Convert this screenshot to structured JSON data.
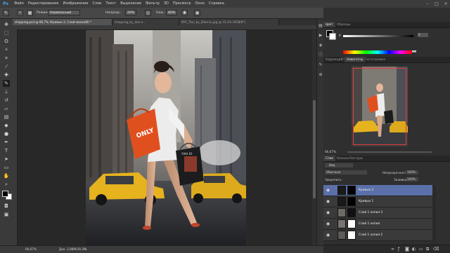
{
  "app": {
    "logo": "Ps"
  },
  "menu": [
    "Файл",
    "Редактирование",
    "Изображение",
    "Слои",
    "Текст",
    "Выделение",
    "Фильтр",
    "3D",
    "Просмотр",
    "Окно",
    "Справка"
  ],
  "options": {
    "mode_label": "Режим:",
    "mode_value": "Нормальный",
    "opacity_label": "Непрозр.:",
    "opacity_value": "20%",
    "flow_label": "Наж.:",
    "flow_value": "80%",
    "workspace": "Основная рабочая среда"
  },
  "tabs": [
    {
      "label": "shopping.psd @ 66,7% (Кривые 2, Слой-маска/8) *",
      "state": "active"
    },
    {
      "label": "shopping_by_dan-s...",
      "state": "inactive"
    },
    {
      "label": "NYC_Taxi_by_IEbeniu.jpg @ 33,3% (RGB/8*)",
      "state": "inactive"
    }
  ],
  "status": {
    "zoom": "66,67%",
    "doc": "Док: 2,88M/29,3M"
  },
  "color_panel": {
    "tabs": [
      "Цвет",
      "Образцы"
    ],
    "k_value": "0",
    "k_label": "K"
  },
  "adjust_panel": {
    "tabs": [
      "Коррекция",
      "Стили"
    ]
  },
  "nav_panel": {
    "tabs": [
      "Навигатор",
      "Гистограмма"
    ],
    "zoom": "66,67%"
  },
  "layers_panel": {
    "tabs": [
      "Слои",
      "Каналы",
      "Контуры"
    ],
    "kind_label": "Вид",
    "blend_mode": "Обычные",
    "opacity_label": "Непрозрачность:",
    "opacity_value": "100%",
    "lock_label": "Закрепить:",
    "fill_label": "Заливка:",
    "fill_value": "100%",
    "layers": [
      {
        "name": "Кривые 2",
        "selected": true
      },
      {
        "name": "Кривые 1",
        "selected": false
      },
      {
        "name": "Слой 1 копия 3",
        "selected": false
      },
      {
        "name": "Слой 1 копия",
        "selected": false
      },
      {
        "name": "Слой 1 копия 2",
        "selected": false
      }
    ]
  },
  "photo": {
    "bag_text_1": "ONLY",
    "bag_text_2": "YIAH 81"
  },
  "colors": {
    "accent": "#5b6fa8",
    "bag_orange": "#e0501f",
    "taxi_yellow": "#e6b21e"
  }
}
